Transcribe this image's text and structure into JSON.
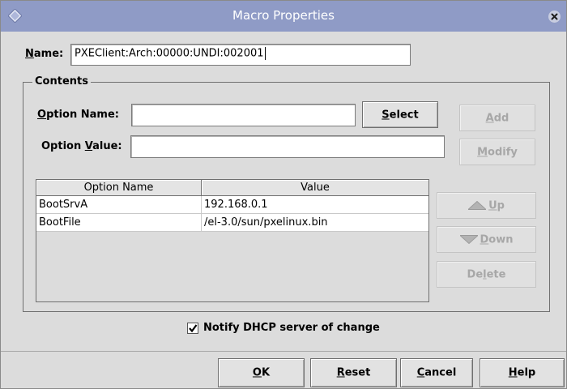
{
  "window": {
    "title": "Macro Properties",
    "titlebar_color": "#8f9bc6"
  },
  "name_field": {
    "label_mnemonic": "N",
    "label_rest": "ame:",
    "value": "PXEClient:Arch:00000:UNDI:002001"
  },
  "contents": {
    "group_title": "Contents",
    "option_name": {
      "label_mnemonic": "O",
      "label_rest": "ption Name:",
      "value": ""
    },
    "option_value": {
      "label_pre": "Option ",
      "label_mnemonic": "V",
      "label_rest": "alue:",
      "value": ""
    },
    "select_button": {
      "mnemonic": "S",
      "rest": "elect"
    },
    "add_button": {
      "mnemonic": "A",
      "rest": "dd"
    },
    "modify_button": {
      "mnemonic": "M",
      "rest": "odify"
    },
    "up_button": {
      "mnemonic": "U",
      "rest": "p"
    },
    "down_button": {
      "mnemonic": "D",
      "rest": "own"
    },
    "delete_button": {
      "pre": "De",
      "mnemonic": "l",
      "rest": "ete"
    },
    "table": {
      "columns": [
        "Option Name",
        "Value"
      ],
      "rows": [
        {
          "name": "BootSrvA",
          "value": "192.168.0.1"
        },
        {
          "name": "BootFile",
          "value": "/el-3.0/sun/pxelinux.bin"
        }
      ]
    }
  },
  "notify": {
    "checked": true,
    "label": "Notify DHCP server of change"
  },
  "footer": {
    "ok": {
      "mnemonic": "O",
      "rest": "K"
    },
    "reset": {
      "mnemonic": "R",
      "rest": "eset"
    },
    "cancel": {
      "mnemonic": "C",
      "rest": "ancel"
    },
    "help": {
      "mnemonic": "H",
      "rest": "elp"
    }
  }
}
